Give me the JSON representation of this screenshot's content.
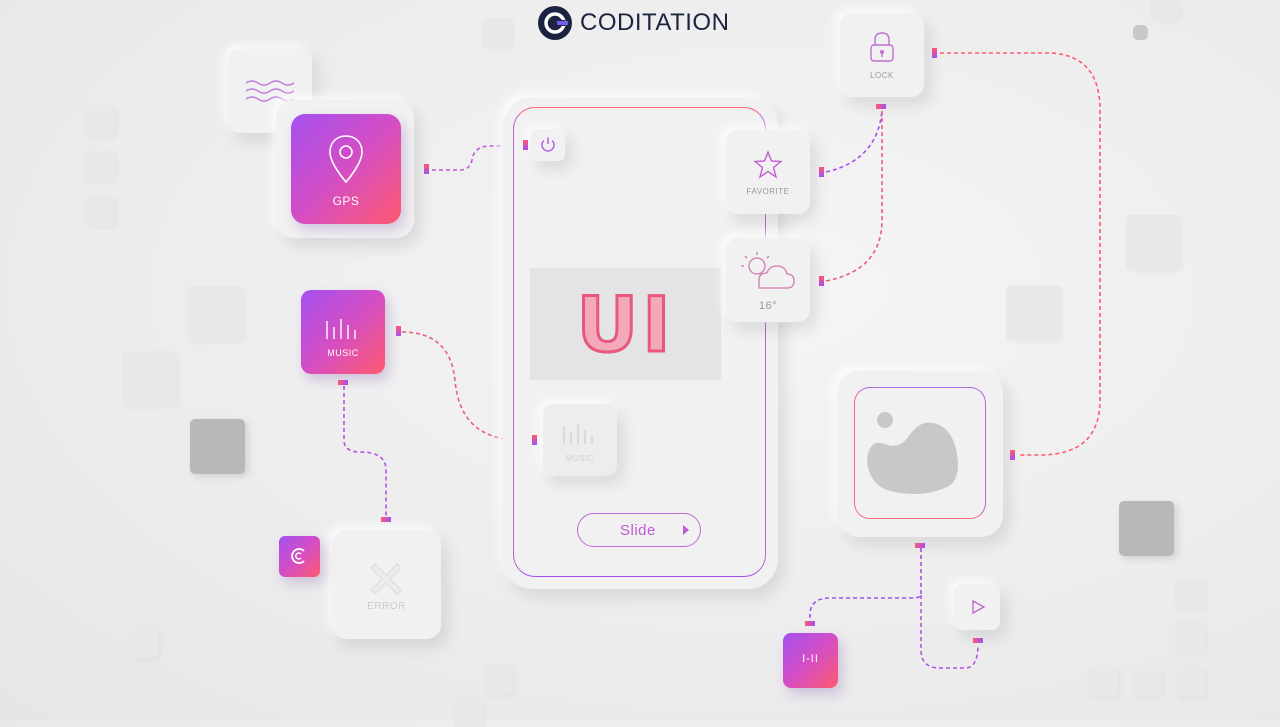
{
  "brand": {
    "name": "CODITATION"
  },
  "phone": {
    "headline": "UI",
    "slide_label": "Slide",
    "inner_music_label": "MUSIC"
  },
  "tiles": {
    "gps": "GPS",
    "music": "MUSIC",
    "favorite": "FAVORITE",
    "weather_temp": "16°",
    "lock": "LOCK",
    "error": "ERROR",
    "pause_label": "I-II"
  },
  "icons": {
    "logo": "coditation-logo-icon",
    "waves": "waves-icon",
    "gps": "location-pin-icon",
    "power": "power-icon",
    "star": "star-icon",
    "weather": "sun-cloud-icon",
    "lock": "padlock-icon",
    "music": "equalizer-icon",
    "image": "image-icon",
    "error": "x-icon",
    "c": "c-logo-icon",
    "play": "play-icon"
  },
  "colors": {
    "accent_purple": "#a450f0",
    "accent_pink": "#ff5a6e",
    "brand_navy": "#1c2340"
  }
}
